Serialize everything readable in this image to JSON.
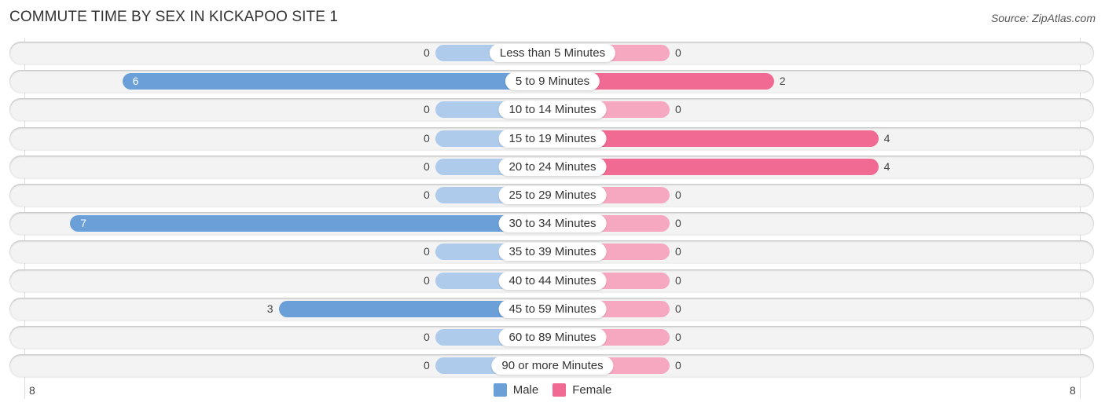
{
  "title": "COMMUTE TIME BY SEX IN KICKAPOO SITE 1",
  "source": "Source: ZipAtlas.com",
  "colors": {
    "male": "#6a9fd8",
    "male_zero": "#aecbec",
    "female": "#f06a93",
    "female_zero": "#f7a8c1"
  },
  "chart_data": {
    "type": "bar",
    "orientation": "horizontal-diverging",
    "title": "COMMUTE TIME BY SEX IN KICKAPOO SITE 1",
    "categories": [
      "Less than 5 Minutes",
      "5 to 9 Minutes",
      "10 to 14 Minutes",
      "15 to 19 Minutes",
      "20 to 24 Minutes",
      "25 to 29 Minutes",
      "30 to 34 Minutes",
      "35 to 39 Minutes",
      "40 to 44 Minutes",
      "45 to 59 Minutes",
      "60 to 89 Minutes",
      "90 or more Minutes"
    ],
    "series": [
      {
        "name": "Male",
        "values": [
          0,
          6,
          0,
          0,
          0,
          0,
          7,
          0,
          0,
          3,
          0,
          0
        ]
      },
      {
        "name": "Female",
        "values": [
          0,
          2,
          0,
          4,
          4,
          0,
          0,
          0,
          0,
          0,
          0,
          0
        ]
      }
    ],
    "axis_left_label": "8",
    "axis_right_label": "8",
    "xlim": [
      -8,
      8
    ],
    "legend": [
      "Male",
      "Female"
    ],
    "legend_position": "bottom-center"
  }
}
